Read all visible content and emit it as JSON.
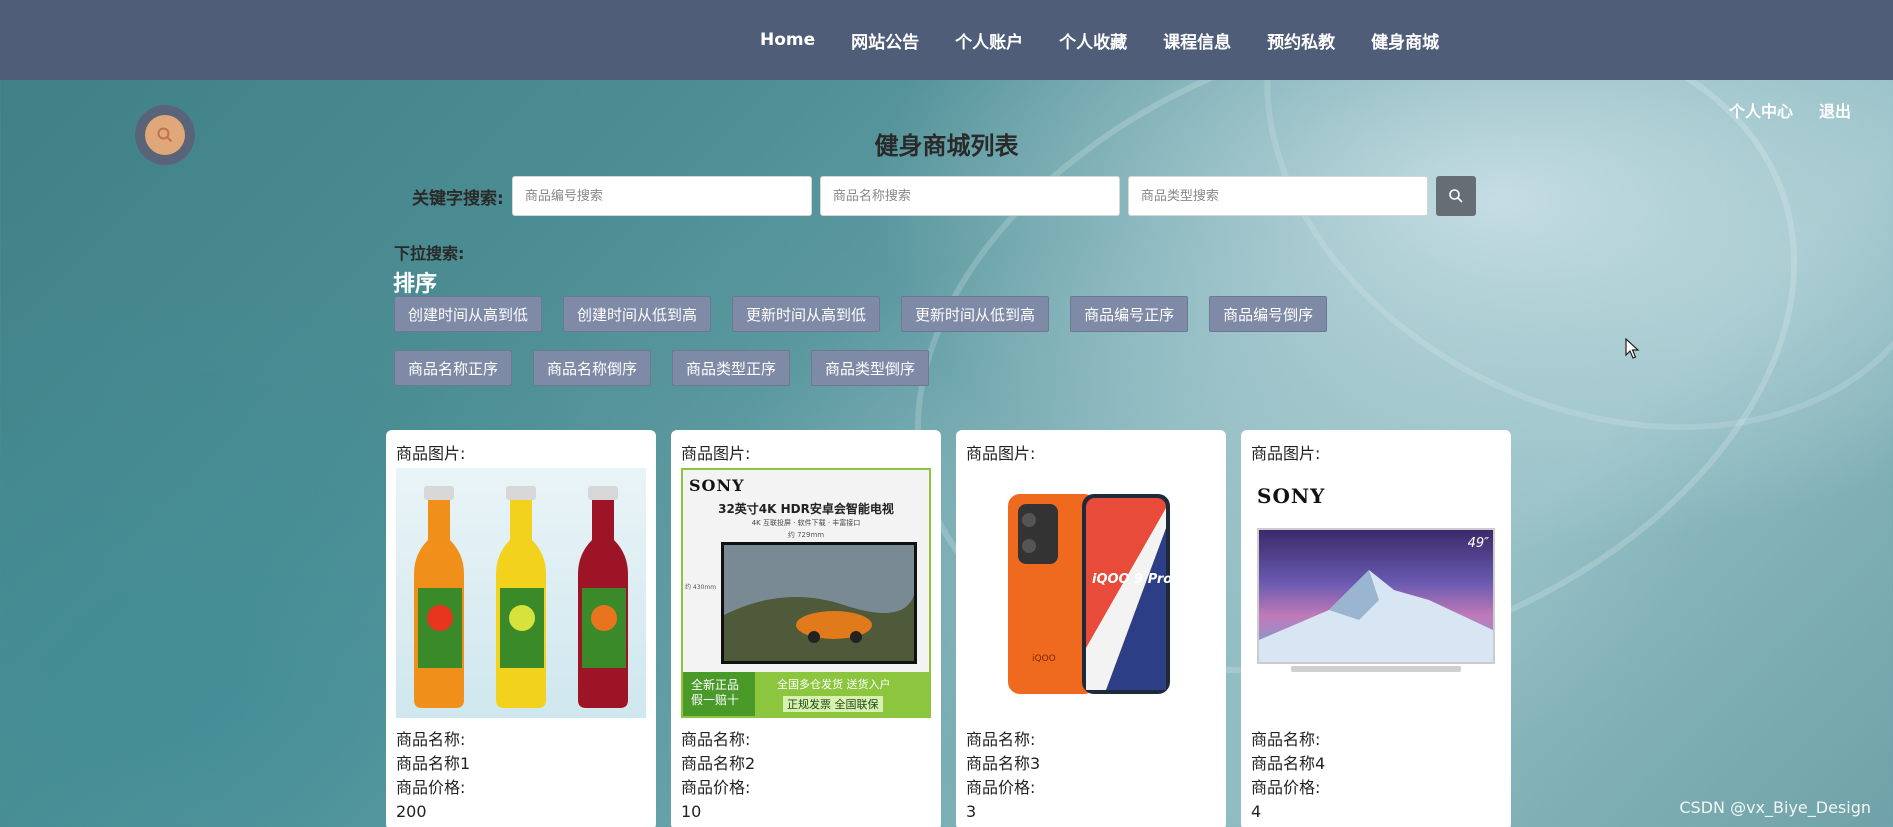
{
  "nav": {
    "items": [
      "Home",
      "网站公告",
      "个人账户",
      "个人收藏",
      "课程信息",
      "预约私教",
      "健身商城"
    ]
  },
  "top_links": {
    "personal_center": "个人中心",
    "logout": "退出"
  },
  "page_title": "健身商城列表",
  "search": {
    "label": "关键字搜索:",
    "placeholders": [
      "商品编号搜索",
      "商品名称搜索",
      "商品类型搜索"
    ],
    "values": [
      "",
      "",
      ""
    ],
    "button_icon": "search-icon"
  },
  "dropdown_label": "下拉搜索:",
  "sort": {
    "title": "排序",
    "row1": [
      "创建时间从高到低",
      "创建时间从低到高",
      "更新时间从高到低",
      "更新时间从低到高",
      "商品编号正序",
      "商品编号倒序"
    ],
    "row2": [
      "商品名称正序",
      "商品名称倒序",
      "商品类型正序",
      "商品类型倒序"
    ]
  },
  "products": [
    {
      "image_label": "商品图片:",
      "name_label": "商品名称:",
      "name": "商品名称1",
      "price_label": "商品价格:",
      "price": "200",
      "image_icon": "juice-bottles-image"
    },
    {
      "image_label": "商品图片:",
      "name_label": "商品名称:",
      "name": "商品名称2",
      "price_label": "商品价格:",
      "price": "10",
      "image_icon": "sony-tv-ad-image",
      "image_text": {
        "brand": "SONY",
        "headline": "32英寸4K HDR安卓会智能电视",
        "sub": "4K 互联投屏 · 软件下载 · 丰富接口",
        "width": "约 729mm",
        "height": "约 430mm",
        "badge_line1": "全新正品",
        "badge_line2": "假一赔十",
        "footer_line1": "全国多仓发货 送货入户",
        "footer_line2": "正规发票 全国联保"
      }
    },
    {
      "image_label": "商品图片:",
      "name_label": "商品名称:",
      "name": "商品名称3",
      "price_label": "商品价格:",
      "price": "3",
      "image_icon": "phone-image",
      "image_text": {
        "model": "iQOO 9 Pro",
        "brand": "iQOO"
      }
    },
    {
      "image_label": "商品图片:",
      "name_label": "商品名称:",
      "name": "商品名称4",
      "price_label": "商品价格:",
      "price": "4",
      "image_icon": "sony-tv-image",
      "image_text": {
        "brand": "SONY",
        "size": "49″"
      }
    }
  ],
  "watermark": "CSDN @vx_Biye_Design",
  "colors": {
    "topbar": "#4f5d78",
    "sort_button": "#7f8aa6",
    "search_button": "#666d74",
    "search_fab_outer": "#5a6478",
    "search_fab_inner": "#e0a87a"
  }
}
